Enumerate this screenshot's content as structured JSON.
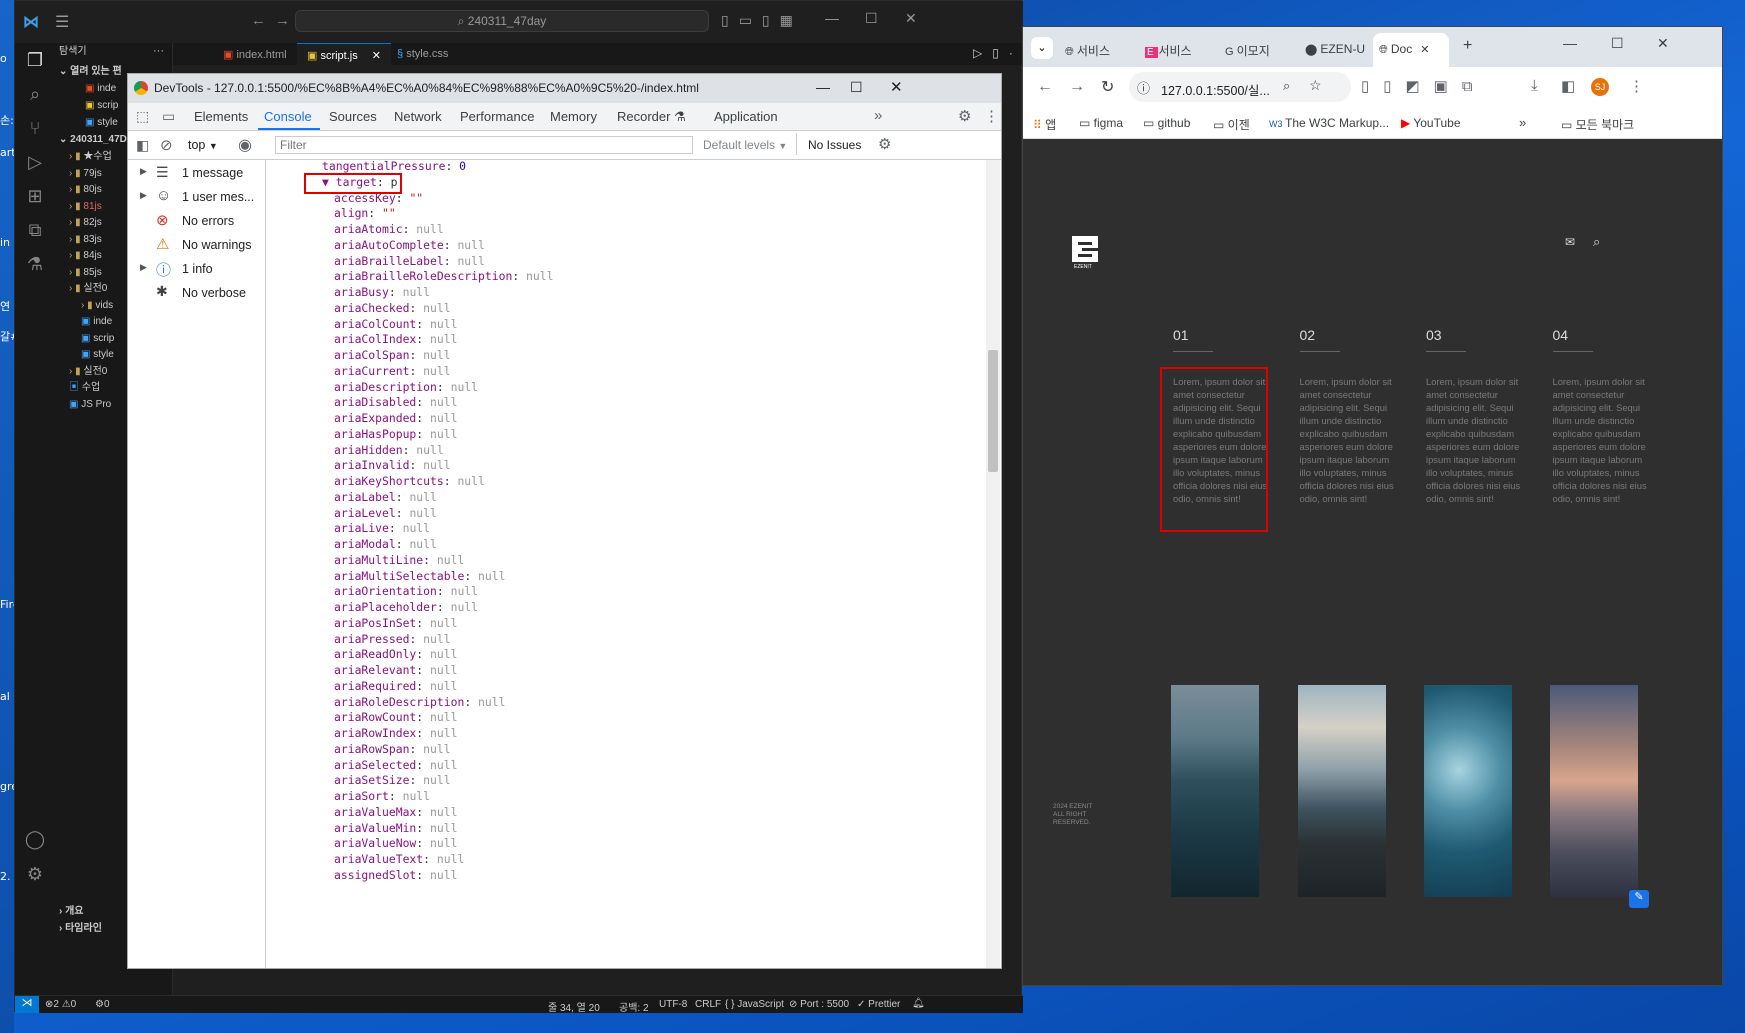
{
  "desktop": {
    "left_labels": [
      "o",
      "손:",
      "art",
      "in li",
      "연",
      "갈#",
      "Fire",
      "al Co",
      "gre",
      "2."
    ]
  },
  "vscode": {
    "search": "240311_47day",
    "explorer_title": "탐색기",
    "open_editors": "열려 있는 편",
    "open_files": [
      "inde",
      "scrip",
      "style"
    ],
    "folder": "240311_47D",
    "tree": [
      "★수업",
      "79js",
      "80js",
      "81js",
      "82js",
      "83js",
      "84js",
      "85js",
      "실전0",
      "vids",
      "inde",
      "scrip",
      "style",
      "실전0",
      "수업",
      "JS Pro"
    ],
    "outline": "개요",
    "timeline": "타임라인",
    "tabs": [
      "index.html",
      "script.js",
      "style.css"
    ],
    "status": {
      "errors": "⊗2 ⚠0",
      "ports": "⚙0",
      "position": "줄 34, 열 20",
      "spaces": "공백: 2",
      "encoding": "UTF-8",
      "eol": "CRLF",
      "language": "{ } JavaScript",
      "port": "⊘ Port : 5500",
      "prettier": "✓ Prettier"
    }
  },
  "devtools": {
    "title": "DevTools - 127.0.0.1:5500/%EC%8B%A4%EC%A0%84%EC%98%88%EC%A0%9C5%20-/index.html",
    "tabs": [
      "Elements",
      "Console",
      "Sources",
      "Network",
      "Performance",
      "Memory",
      "Recorder ⚗",
      "Application"
    ],
    "context": "top",
    "filter_placeholder": "Filter",
    "levels": "Default levels",
    "issues": "No Issues",
    "sidebar": [
      "1 message",
      "1 user mes...",
      "No errors",
      "No warnings",
      "1 info",
      "No verbose"
    ],
    "props": [
      {
        "k": "tangentialPressure",
        "v": "0",
        "t": "num",
        "indent": 0
      },
      {
        "k": "▼ target",
        "v": "p",
        "t": "obj",
        "indent": 0
      },
      {
        "k": "accessKey",
        "v": "\"\"",
        "t": "str",
        "indent": 1
      },
      {
        "k": "align",
        "v": "\"\"",
        "t": "str",
        "indent": 1
      },
      {
        "k": "ariaAtomic",
        "v": "null",
        "t": "null",
        "indent": 1
      },
      {
        "k": "ariaAutoComplete",
        "v": "null",
        "t": "null",
        "indent": 1
      },
      {
        "k": "ariaBrailleLabel",
        "v": "null",
        "t": "null",
        "indent": 1
      },
      {
        "k": "ariaBrailleRoleDescription",
        "v": "null",
        "t": "null",
        "indent": 1
      },
      {
        "k": "ariaBusy",
        "v": "null",
        "t": "null",
        "indent": 1
      },
      {
        "k": "ariaChecked",
        "v": "null",
        "t": "null",
        "indent": 1
      },
      {
        "k": "ariaColCount",
        "v": "null",
        "t": "null",
        "indent": 1
      },
      {
        "k": "ariaColIndex",
        "v": "null",
        "t": "null",
        "indent": 1
      },
      {
        "k": "ariaColSpan",
        "v": "null",
        "t": "null",
        "indent": 1
      },
      {
        "k": "ariaCurrent",
        "v": "null",
        "t": "null",
        "indent": 1
      },
      {
        "k": "ariaDescription",
        "v": "null",
        "t": "null",
        "indent": 1
      },
      {
        "k": "ariaDisabled",
        "v": "null",
        "t": "null",
        "indent": 1
      },
      {
        "k": "ariaExpanded",
        "v": "null",
        "t": "null",
        "indent": 1
      },
      {
        "k": "ariaHasPopup",
        "v": "null",
        "t": "null",
        "indent": 1
      },
      {
        "k": "ariaHidden",
        "v": "null",
        "t": "null",
        "indent": 1
      },
      {
        "k": "ariaInvalid",
        "v": "null",
        "t": "null",
        "indent": 1
      },
      {
        "k": "ariaKeyShortcuts",
        "v": "null",
        "t": "null",
        "indent": 1
      },
      {
        "k": "ariaLabel",
        "v": "null",
        "t": "null",
        "indent": 1
      },
      {
        "k": "ariaLevel",
        "v": "null",
        "t": "null",
        "indent": 1
      },
      {
        "k": "ariaLive",
        "v": "null",
        "t": "null",
        "indent": 1
      },
      {
        "k": "ariaModal",
        "v": "null",
        "t": "null",
        "indent": 1
      },
      {
        "k": "ariaMultiLine",
        "v": "null",
        "t": "null",
        "indent": 1
      },
      {
        "k": "ariaMultiSelectable",
        "v": "null",
        "t": "null",
        "indent": 1
      },
      {
        "k": "ariaOrientation",
        "v": "null",
        "t": "null",
        "indent": 1
      },
      {
        "k": "ariaPlaceholder",
        "v": "null",
        "t": "null",
        "indent": 1
      },
      {
        "k": "ariaPosInSet",
        "v": "null",
        "t": "null",
        "indent": 1
      },
      {
        "k": "ariaPressed",
        "v": "null",
        "t": "null",
        "indent": 1
      },
      {
        "k": "ariaReadOnly",
        "v": "null",
        "t": "null",
        "indent": 1
      },
      {
        "k": "ariaRelevant",
        "v": "null",
        "t": "null",
        "indent": 1
      },
      {
        "k": "ariaRequired",
        "v": "null",
        "t": "null",
        "indent": 1
      },
      {
        "k": "ariaRoleDescription",
        "v": "null",
        "t": "null",
        "indent": 1
      },
      {
        "k": "ariaRowCount",
        "v": "null",
        "t": "null",
        "indent": 1
      },
      {
        "k": "ariaRowIndex",
        "v": "null",
        "t": "null",
        "indent": 1
      },
      {
        "k": "ariaRowSpan",
        "v": "null",
        "t": "null",
        "indent": 1
      },
      {
        "k": "ariaSelected",
        "v": "null",
        "t": "null",
        "indent": 1
      },
      {
        "k": "ariaSetSize",
        "v": "null",
        "t": "null",
        "indent": 1
      },
      {
        "k": "ariaSort",
        "v": "null",
        "t": "null",
        "indent": 1
      },
      {
        "k": "ariaValueMax",
        "v": "null",
        "t": "null",
        "indent": 1
      },
      {
        "k": "ariaValueMin",
        "v": "null",
        "t": "null",
        "indent": 1
      },
      {
        "k": "ariaValueNow",
        "v": "null",
        "t": "null",
        "indent": 1
      },
      {
        "k": "ariaValueText",
        "v": "null",
        "t": "null",
        "indent": 1
      },
      {
        "k": "assignedSlot",
        "v": "null",
        "t": "null",
        "indent": 1
      }
    ]
  },
  "browser": {
    "tabs": [
      "서비스",
      "서비스",
      "이모지",
      "EZEN-U",
      "Doc"
    ],
    "url": "127.0.0.1:5500/실...",
    "profile": "SJ",
    "bookmarks": [
      "앱",
      "figma",
      "github",
      "이젠",
      "The W3C Markup...",
      "YouTube"
    ],
    "all_bookmarks": "모든 북마크",
    "page": {
      "logo_text": "EZENIT",
      "footer": "2024 EZENIT ALL RIGHT RESERVED.",
      "columns": [
        {
          "num": "01",
          "text": "Lorem, ipsum dolor sit amet consectetur adipisicing elit. Sequi illum unde distinctio explicabo quibusdam asperiores eum dolore ipsum itaque laborum illo voluptates, minus officia dolores nisi eius odio, omnis sint!"
        },
        {
          "num": "02",
          "text": "Lorem, ipsum dolor sit amet consectetur adipisicing elit. Sequi illum unde distinctio explicabo quibusdam asperiores eum dolore ipsum itaque laborum illo voluptates, minus officia dolores nisi eius odio, omnis sint!"
        },
        {
          "num": "03",
          "text": "Lorem, ipsum dolor sit amet consectetur adipisicing elit. Sequi illum unde distinctio explicabo quibusdam asperiores eum dolore ipsum itaque laborum illo voluptates, minus officia dolores nisi eius odio, omnis sint!"
        },
        {
          "num": "04",
          "text": "Lorem, ipsum dolor sit amet consectetur adipisicing elit. Sequi illum unde distinctio explicabo quibusdam asperiores eum dolore ipsum itaque laborum illo voluptates, minus officia dolores nisi eius odio, omnis sint!"
        }
      ]
    }
  },
  "colors": {
    "highlight": "#e00000",
    "vscode_accent": "#0078d4",
    "devtools_blue": "#1a73e8"
  }
}
